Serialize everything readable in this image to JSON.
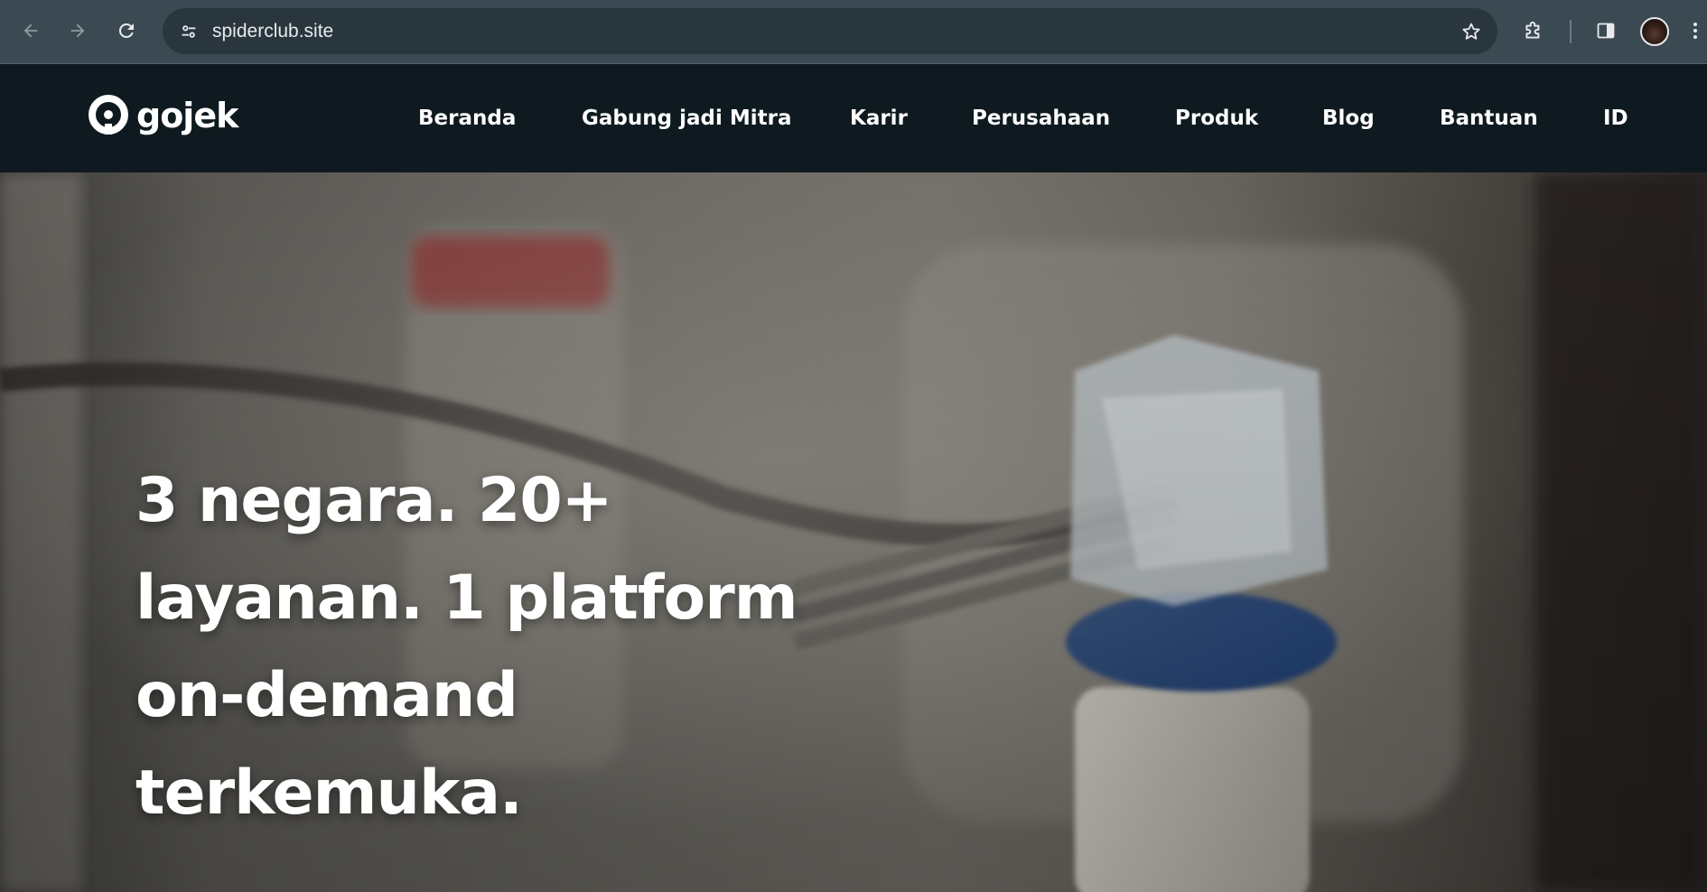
{
  "browser": {
    "url": "spiderclub.site",
    "icons": {
      "back": "arrow-left-icon",
      "forward": "arrow-right-icon",
      "reload": "reload-icon",
      "site_settings": "tune-icon",
      "bookmark": "star-icon",
      "extensions": "puzzle-icon",
      "side_panel": "side-panel-icon",
      "profile": "avatar",
      "menu": "more-vert-icon"
    }
  },
  "site": {
    "logo_text": "gojek",
    "nav": [
      {
        "label": "Beranda"
      },
      {
        "label": "Gabung jadi Mitra"
      },
      {
        "label": "Karir"
      },
      {
        "label": "Perusahaan"
      },
      {
        "label": "Produk"
      },
      {
        "label": "Blog"
      },
      {
        "label": "Bantuan"
      },
      {
        "label": "ID"
      }
    ]
  },
  "hero": {
    "headline_lines": [
      "3 negara. 20+",
      "layanan. 1 platform",
      "on-demand",
      "terkemuka."
    ]
  },
  "colors": {
    "chrome_bg": "#3b4a52",
    "omnibox_bg": "#2a363d",
    "header_bg": "#0e1a1f",
    "text_white": "#ffffff"
  }
}
